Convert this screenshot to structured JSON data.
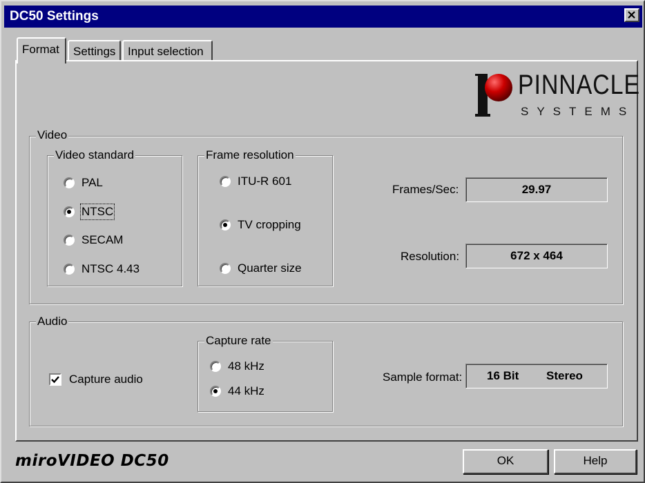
{
  "window": {
    "title": "DC50 Settings"
  },
  "tabs": [
    {
      "label": "Format",
      "active": true
    },
    {
      "label": "Settings",
      "active": false
    },
    {
      "label": "Input selection",
      "active": false
    }
  ],
  "logo": {
    "line1": "PINNACLE",
    "line2": "SYSTEMS",
    "ball_color": "#cc0000"
  },
  "video": {
    "legend": "Video",
    "standard": {
      "legend": "Video standard",
      "options": [
        {
          "label": "PAL",
          "selected": false
        },
        {
          "label": "NTSC",
          "selected": true
        },
        {
          "label": "SECAM",
          "selected": false
        },
        {
          "label": "NTSC 4.43",
          "selected": false
        }
      ]
    },
    "frame_resolution": {
      "legend": "Frame resolution",
      "options": [
        {
          "label": "ITU-R 601",
          "selected": false
        },
        {
          "label": "TV cropping",
          "selected": true
        },
        {
          "label": "Quarter size",
          "selected": false
        }
      ]
    },
    "fps_label": "Frames/Sec:",
    "fps_value": "29.97",
    "resolution_label": "Resolution:",
    "resolution_value": "672 x 464"
  },
  "audio": {
    "legend": "Audio",
    "capture_audio_label": "Capture audio",
    "capture_audio_checked": true,
    "capture_rate": {
      "legend": "Capture rate",
      "options": [
        {
          "label": "48 kHz",
          "selected": false
        },
        {
          "label": "44 kHz",
          "selected": true
        }
      ]
    },
    "sample_format_label": "Sample format:",
    "sample_format_bits": "16 Bit",
    "sample_format_channels": "Stereo"
  },
  "footer": {
    "brand": "miroVIDEO DC50",
    "ok_label": "OK",
    "help_label": "Help"
  }
}
